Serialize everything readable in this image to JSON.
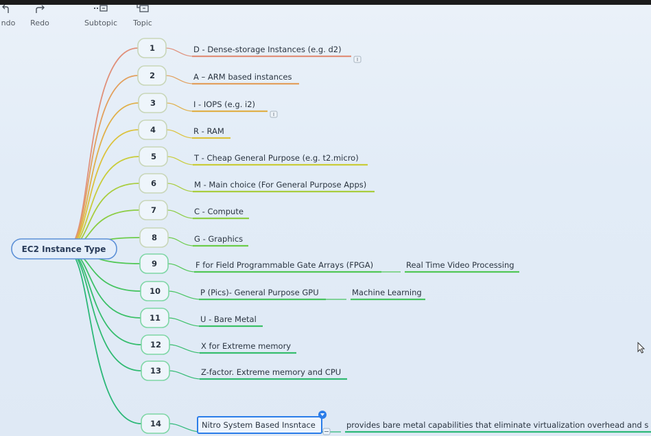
{
  "toolbar": {
    "undo_label": "ndo",
    "redo_label": "Redo",
    "subtopic_label": "Subtopic",
    "topic_label": "Topic"
  },
  "mindmap": {
    "central_topic": "EC2 Instance Type",
    "branches": [
      {
        "num": "1",
        "label": "D - Dense-storage Instances (e.g. d2)",
        "color": "#e0907a",
        "note": true
      },
      {
        "num": "2",
        "label": "A – ARM based instances",
        "color": "#e2a05e"
      },
      {
        "num": "3",
        "label": "I - IOPS (e.g. i2)",
        "color": "#e0b04a",
        "note": true
      },
      {
        "num": "4",
        "label": "R - RAM",
        "color": "#dcc23c"
      },
      {
        "num": "5",
        "label": "T - Cheap General Purpose (e.g. t2.micro)",
        "color": "#c9cc3a"
      },
      {
        "num": "6",
        "label": "M - Main choice (For General Purpose Apps)",
        "color": "#a9cd3e"
      },
      {
        "num": "7",
        "label": "C - Compute",
        "color": "#8ccd44"
      },
      {
        "num": "8",
        "label": "G - Graphics",
        "color": "#6ccc4a"
      },
      {
        "num": "9",
        "label": "F for Field Programmable Gate Arrays (FPGA)",
        "color": "#52c856",
        "child": "Real Time Video Processing"
      },
      {
        "num": "10",
        "label": "P (Pics)- General Purpose GPU",
        "color": "#46c460",
        "child": "Machine Learning"
      },
      {
        "num": "11",
        "label": "U - Bare Metal",
        "color": "#3cc068"
      },
      {
        "num": "12",
        "label": "X for Extreme memory",
        "color": "#36bd6e"
      },
      {
        "num": "13",
        "label": "Z-factor. Extreme memory and CPU",
        "color": "#30ba72"
      },
      {
        "num": "14",
        "label": "Nitro System Based Insntace",
        "color": "#2cb878",
        "child": "provides bare metal capabilities that eliminate virtualization overhead and s",
        "selected": true
      }
    ]
  },
  "colors": {
    "central_border": "#5b8fd6",
    "selection": "#2b7de9",
    "node_border": "#86d8a8"
  }
}
